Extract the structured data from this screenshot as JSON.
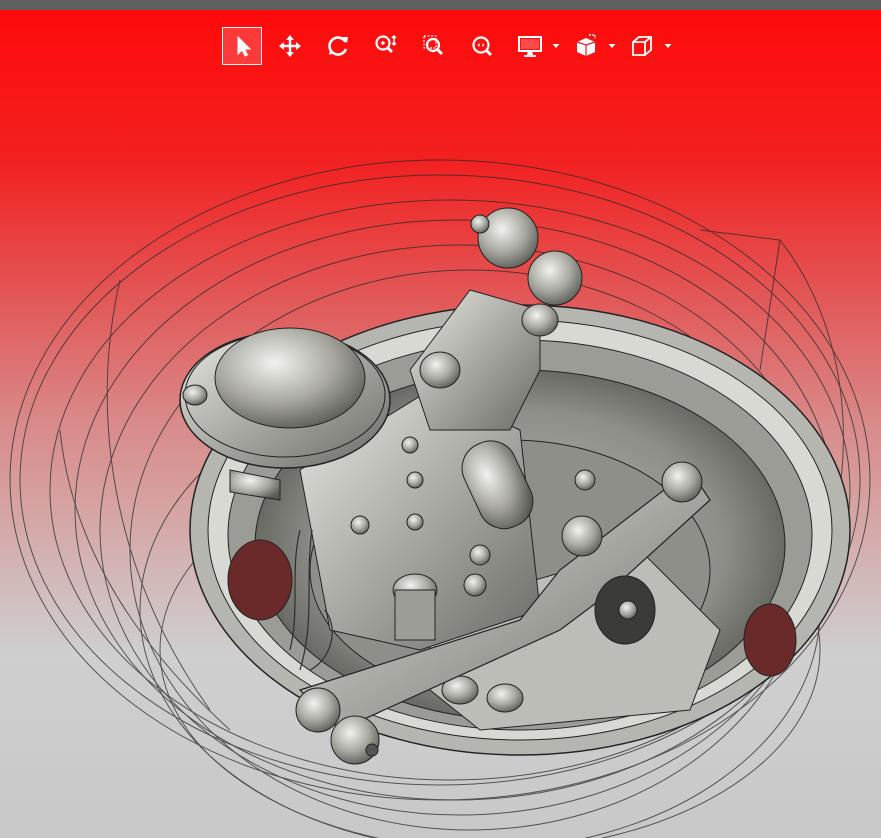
{
  "app": {
    "title": "",
    "viewport_background": {
      "top": "#ff0a0a",
      "bottom": "#c8c8c8"
    },
    "accent": "#ff0000"
  },
  "toolbar": {
    "items": [
      {
        "icon": "select-arrow-icon",
        "active": true
      },
      {
        "icon": "pan-icon",
        "active": false
      },
      {
        "icon": "rotate-icon",
        "active": false
      },
      {
        "icon": "zoom-icon",
        "active": false
      },
      {
        "icon": "zoom-window-icon",
        "active": false
      },
      {
        "icon": "zoom-fit-icon",
        "active": false
      },
      {
        "icon": "display-mode-icon",
        "active": false,
        "has_dropdown": true
      },
      {
        "icon": "section-view-icon",
        "active": false,
        "has_dropdown": true
      },
      {
        "icon": "view-cube-icon",
        "active": false,
        "has_dropdown": true
      }
    ]
  },
  "model": {
    "description_shown": false,
    "render_style": "shaded-with-edges",
    "wheel_style": "wireframe"
  }
}
